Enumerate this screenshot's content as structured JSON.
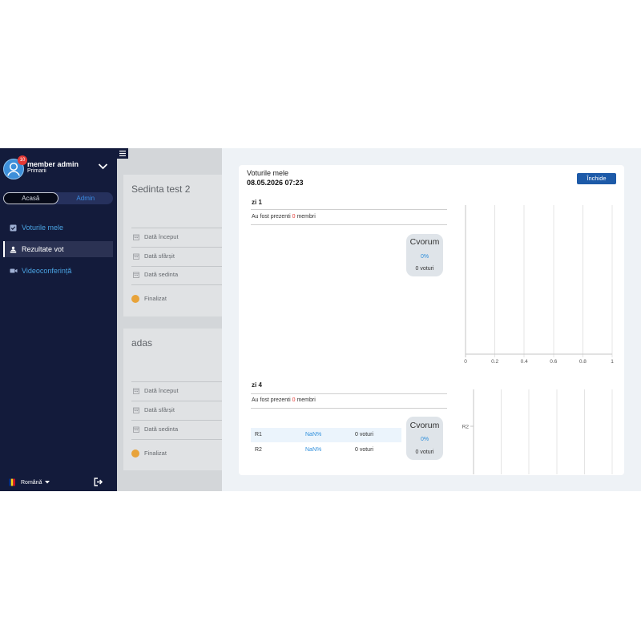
{
  "colors": {
    "sidebar_bg": "#131b3b",
    "accent_blue": "#2f8fdc",
    "button_blue": "#1d5aa8",
    "status_orange": "#e8a33a",
    "count_red": "#e53935"
  },
  "sidebar": {
    "menu_toggle_icon": "hamburger-icon",
    "user": {
      "name": "member admin",
      "organization": "Primarii",
      "badge": "10",
      "icon": "user-icon"
    },
    "toggle": {
      "home": "Acasă",
      "admin": "Admin"
    },
    "menu": [
      {
        "label": "Voturile mele",
        "icon": "check-square-icon",
        "active": false
      },
      {
        "label": "Rezultate vot",
        "icon": "podium-icon",
        "active": true
      },
      {
        "label": "Videoconferință",
        "icon": "video-icon",
        "active": false
      }
    ],
    "language": {
      "label": "Română",
      "icon": "romania-flag-icon"
    },
    "logout_icon": "logout-icon"
  },
  "sessions": [
    {
      "title": "Sedinta test 2",
      "fields": [
        "Dată început",
        "Dată sfârșit",
        "Dată sedinta"
      ],
      "status": "Finalizat"
    },
    {
      "title": "adas",
      "fields": [
        "Dată început",
        "Dată sfârșit",
        "Dată sedinta"
      ],
      "status": "Finalizat"
    }
  ],
  "modal": {
    "title": "Voturile mele",
    "datetime": "08.05.2026 07:23",
    "close_label": "Închide",
    "days": [
      {
        "name": "zi 1",
        "presence": {
          "prefix": "Au fost prezenti",
          "count": "0",
          "suffix": "membri"
        },
        "results": [],
        "quorum": {
          "label": "Cvorum",
          "percent": "0%",
          "votes": "0 voturi"
        }
      },
      {
        "name": "zi 4",
        "presence": {
          "prefix": "Au fost prezenti",
          "count": "0",
          "suffix": "membri"
        },
        "results": [
          {
            "option": "R1",
            "percent": "NaN%",
            "votes": "0 voturi"
          },
          {
            "option": "R2",
            "percent": "NaN%",
            "votes": "0 voturi"
          }
        ],
        "quorum": {
          "label": "Cvorum",
          "percent": "0%",
          "votes": "0 voturi"
        }
      }
    ]
  },
  "chart_data": [
    {
      "type": "bar",
      "orientation": "horizontal",
      "xlim": [
        0,
        1
      ],
      "x_ticks": [
        "0",
        "0.2",
        "0.4",
        "0.6",
        "0.8",
        "1"
      ],
      "categories": [],
      "grid": true
    },
    {
      "type": "bar",
      "orientation": "horizontal",
      "categories": [
        "R2"
      ],
      "grid": true
    }
  ]
}
